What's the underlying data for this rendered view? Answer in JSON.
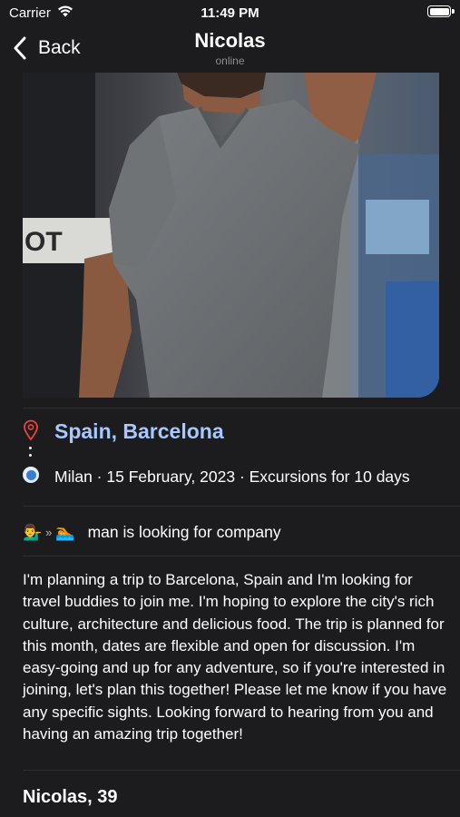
{
  "status_bar": {
    "carrier": "Carrier",
    "time": "11:49 PM"
  },
  "nav": {
    "back_label": "Back",
    "title": "Nicolas",
    "subtitle": "online"
  },
  "trip": {
    "destination": "Spain, Barcelona",
    "origin_line": "Milan · 15 February, 2023 · Excursions for 10 days",
    "company_text": "man is looking for company",
    "company_from_emoji": "💁‍♂️",
    "company_separator": "»",
    "company_to_emoji": "🏊",
    "description": "I'm planning a trip to Barcelona, Spain and I'm looking for travel buddies to join me. I'm hoping to explore the city's rich culture, architecture and delicious food. The trip is planned for this month, dates are flexible and open for discussion. I'm easy-going and up for any adventure, so if you're interested in joining, let's plan this together! Please let me know if you have any specific sights. Looking forward to hearing from you and having an amazing trip together!"
  },
  "profile": {
    "name_age": "Nicolas, 39"
  },
  "colors": {
    "background": "#1c1c1e",
    "destination": "#a6c8ff",
    "pin": "#e8453c",
    "origin": "#3a7bd5"
  }
}
